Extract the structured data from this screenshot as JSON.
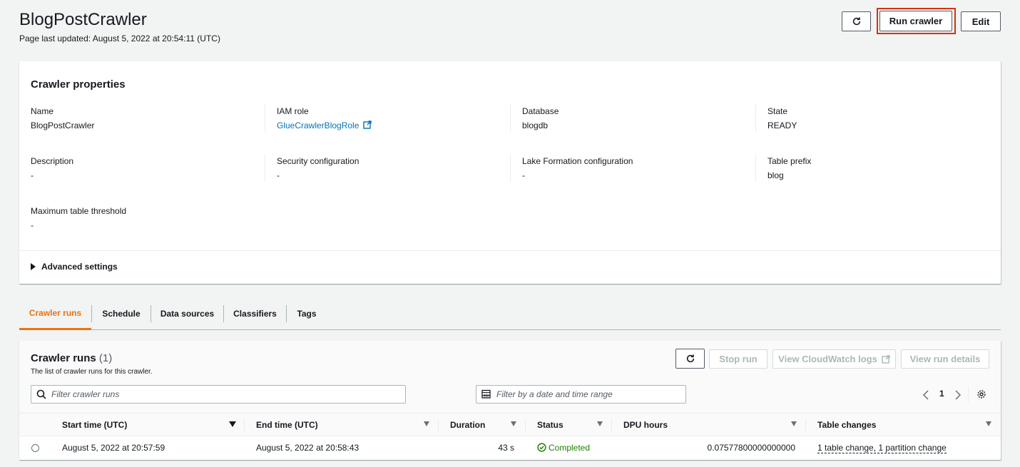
{
  "page": {
    "title": "BlogPostCrawler",
    "last_updated": "Page last updated: August 5, 2022 at 20:54:11 (UTC)"
  },
  "toolbar": {
    "refresh_icon": "refresh-icon",
    "run_label": "Run crawler",
    "edit_label": "Edit"
  },
  "properties": {
    "title": "Crawler properties",
    "name_label": "Name",
    "name_value": "BlogPostCrawler",
    "iam_label": "IAM role",
    "iam_value": "GlueCrawlerBlogRole",
    "database_label": "Database",
    "database_value": "blogdb",
    "state_label": "State",
    "state_value": "READY",
    "description_label": "Description",
    "description_value": "-",
    "security_label": "Security configuration",
    "security_value": "-",
    "lakeformation_label": "Lake Formation configuration",
    "lakeformation_value": "-",
    "prefix_label": "Table prefix",
    "prefix_value": "blog",
    "threshold_label": "Maximum table threshold",
    "threshold_value": "-",
    "advanced_label": "Advanced settings"
  },
  "tabs": [
    {
      "label": "Crawler runs"
    },
    {
      "label": "Schedule"
    },
    {
      "label": "Data sources"
    },
    {
      "label": "Classifiers"
    },
    {
      "label": "Tags"
    }
  ],
  "runs": {
    "title": "Crawler runs",
    "count": "(1)",
    "description": "The list of crawler runs for this crawler.",
    "stop_label": "Stop run",
    "cloudwatch_label": "View CloudWatch logs",
    "details_label": "View run details",
    "filter_placeholder": "Filter crawler runs",
    "date_placeholder": "Filter by a date and time range",
    "page_number": "1",
    "columns": [
      "Start time (UTC)",
      "End time (UTC)",
      "Duration",
      "Status",
      "DPU hours",
      "Table changes"
    ],
    "rows": [
      {
        "start": "August 5, 2022 at 20:57:59",
        "end": "August 5, 2022 at 20:58:43",
        "duration": "43 s",
        "status": "Completed",
        "dpu": "0.07577800000000000",
        "changes": "1 table change, 1 partition change"
      }
    ]
  },
  "colors": {
    "accent": "#ec7211",
    "link": "#0073bb",
    "success": "#1d8102",
    "highlight": "#d13212"
  }
}
